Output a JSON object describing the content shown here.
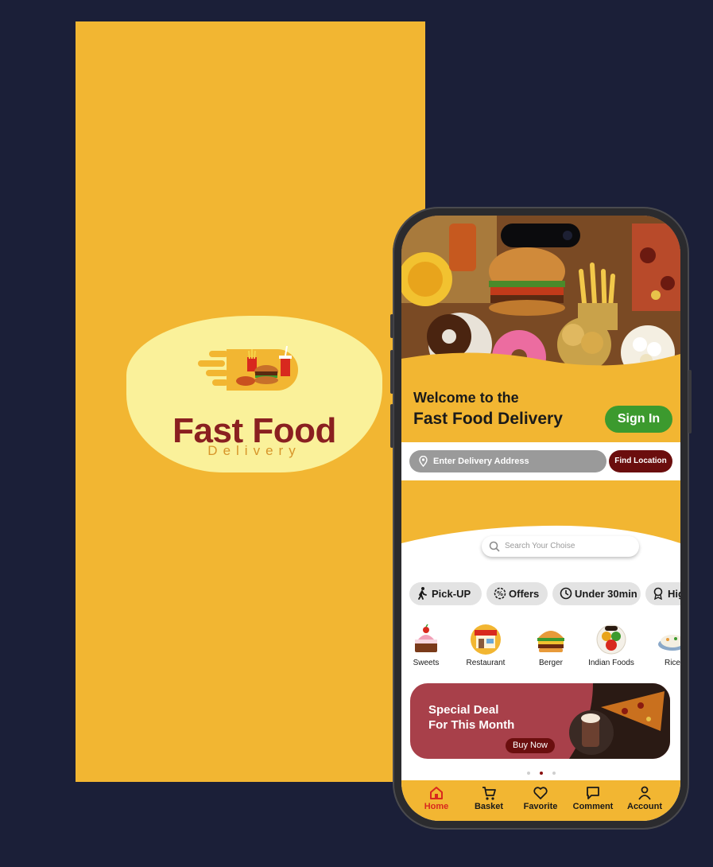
{
  "colors": {
    "background": "#1b1f38",
    "brand_yellow": "#f2b632",
    "brand_red": "#8a2020",
    "accent_green": "#3c9a2e",
    "dark_maroon": "#6b0e0e",
    "deal_red": "#a8404a"
  },
  "splash": {
    "logo_title": "Fast Food",
    "logo_subtitle": "Delivery"
  },
  "home": {
    "welcome_line1": "Welcome to the",
    "welcome_line2": "Fast Food Delivery",
    "signin_label": "Sign In",
    "address_placeholder": "Enter Delivery Address",
    "find_location_label": "Find Location",
    "search_placeholder": "Search Your Choise",
    "filters": [
      {
        "label": "Pick-UP",
        "icon": "walking-icon"
      },
      {
        "label": "Offers",
        "icon": "percent-badge-icon"
      },
      {
        "label": "Under 30min",
        "icon": "clock-icon"
      },
      {
        "label": "High",
        "icon": "medal-icon"
      }
    ],
    "categories": [
      {
        "label": "Sweets",
        "icon": "cake-icon"
      },
      {
        "label": "Restaurant",
        "icon": "restaurant-icon"
      },
      {
        "label": "Berger",
        "icon": "burger-icon"
      },
      {
        "label": "Indian Foods",
        "icon": "indian-food-icon"
      },
      {
        "label": "Rice",
        "icon": "rice-icon"
      }
    ],
    "deal": {
      "line1": "Special Deal",
      "line2": "For This Month",
      "button": "Buy Now"
    },
    "carousel": {
      "count": 3,
      "active": 1
    },
    "nav": [
      {
        "label": "Home",
        "icon": "home-icon",
        "active": true
      },
      {
        "label": "Basket",
        "icon": "cart-icon",
        "active": false
      },
      {
        "label": "Favorite",
        "icon": "heart-icon",
        "active": false
      },
      {
        "label": "Comment",
        "icon": "comment-icon",
        "active": false
      },
      {
        "label": "Account",
        "icon": "user-icon",
        "active": false
      }
    ]
  }
}
